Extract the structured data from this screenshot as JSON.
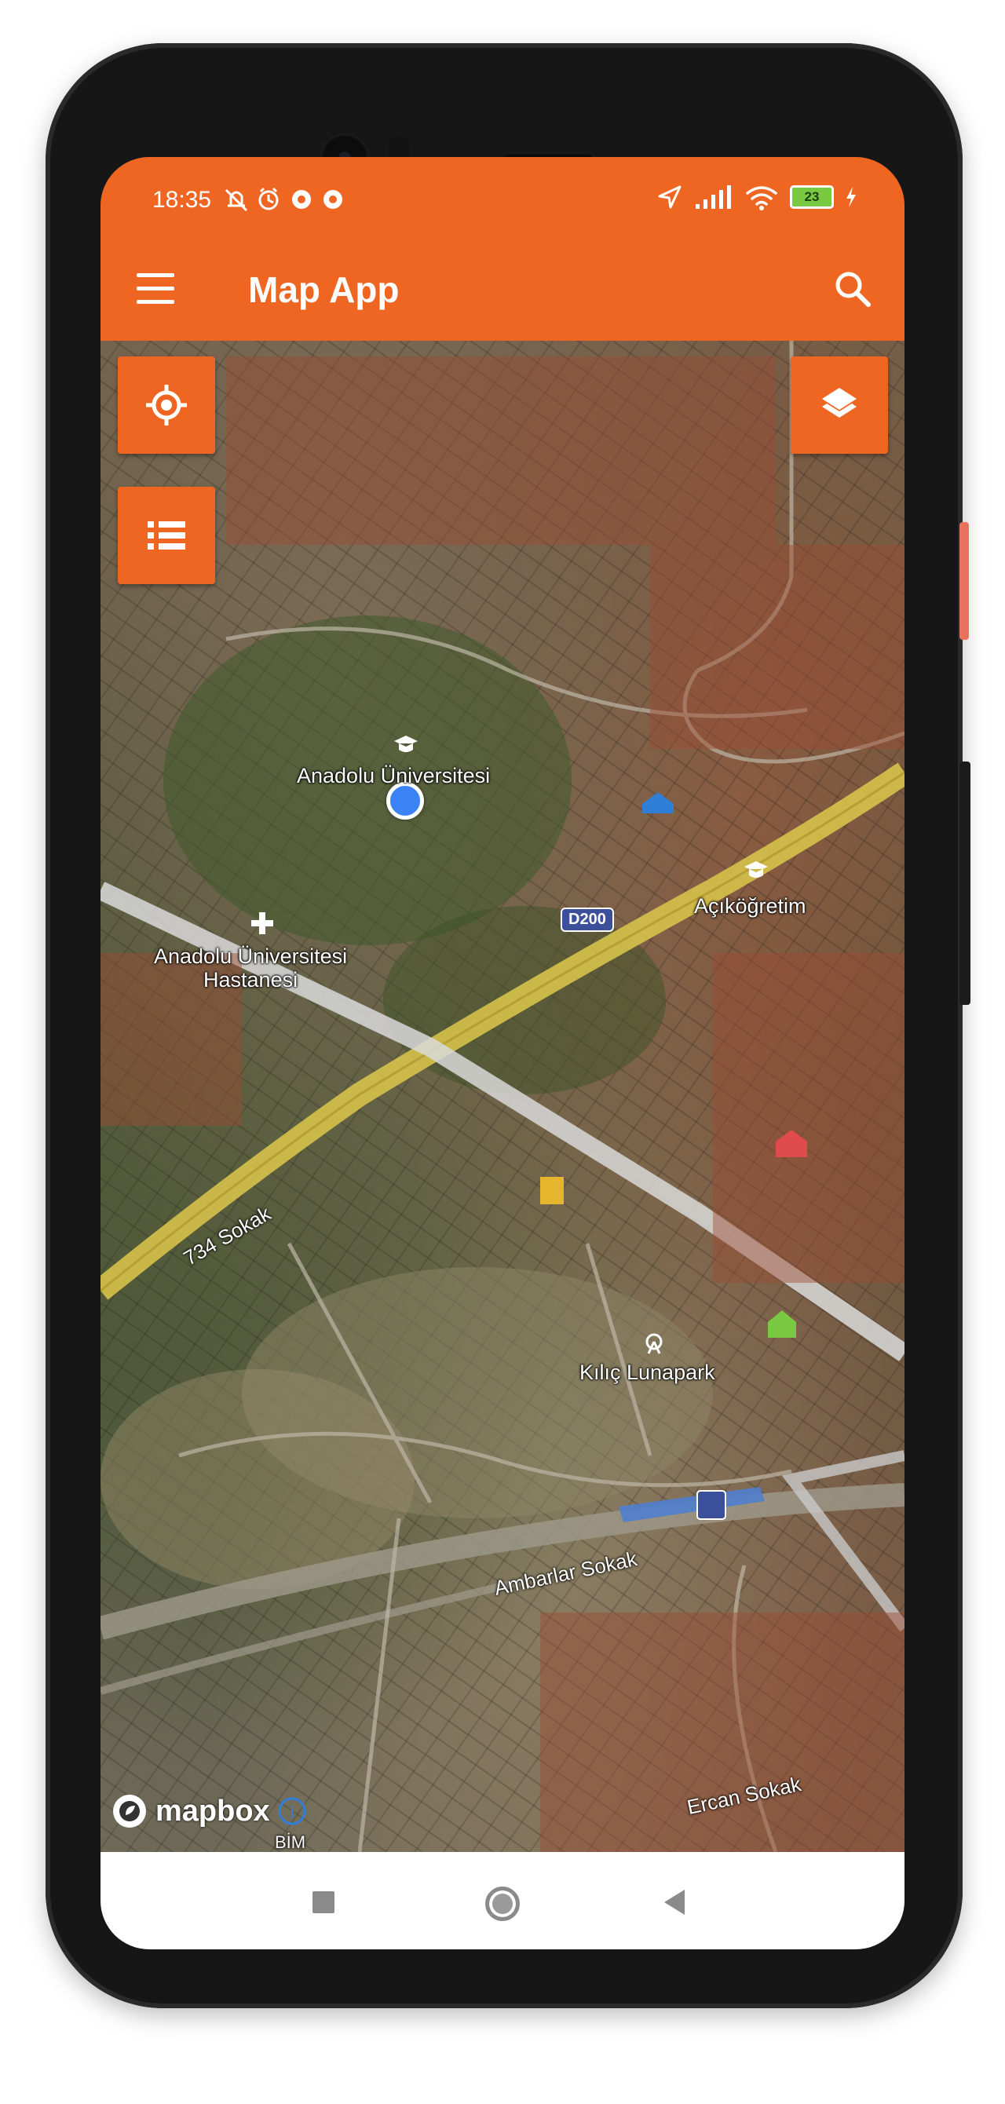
{
  "status_bar": {
    "time": "18:35",
    "left_icons": [
      "mute-icon",
      "alarm-icon",
      "app-icon",
      "app-icon"
    ],
    "right_icons": [
      "location-arrow-icon",
      "signal-icon",
      "wifi-icon"
    ],
    "battery_level": "23"
  },
  "app_bar": {
    "title": "Map App",
    "menu_icon": "hamburger-menu-icon",
    "search_icon": "search-icon"
  },
  "map": {
    "buttons": {
      "locate_icon": "gps-crosshair-icon",
      "list_icon": "list-icon",
      "layers_icon": "layers-icon"
    },
    "labels": {
      "university": "Anadolu Üniversitesi",
      "hospital_line1": "Anadolu Üniversitesi",
      "hospital_line2": "Hastanesi",
      "acikogretim": "Açıköğretim",
      "lunapark": "Kılıç Lunapark",
      "ambarlar": "Ambarlar Sokak",
      "sokak734": "734 Sokak",
      "ercan": "Ercan Sokak",
      "bim": "BİM",
      "d200": "D200",
      "attribution": "mapbox"
    }
  },
  "nav_bar": {
    "icons": [
      "recents-square-icon",
      "home-circle-icon",
      "back-triangle-icon"
    ]
  },
  "colors": {
    "accent": "#ef6622",
    "location_dot": "#3b82f6",
    "road_yellow": "#d6c24a"
  }
}
